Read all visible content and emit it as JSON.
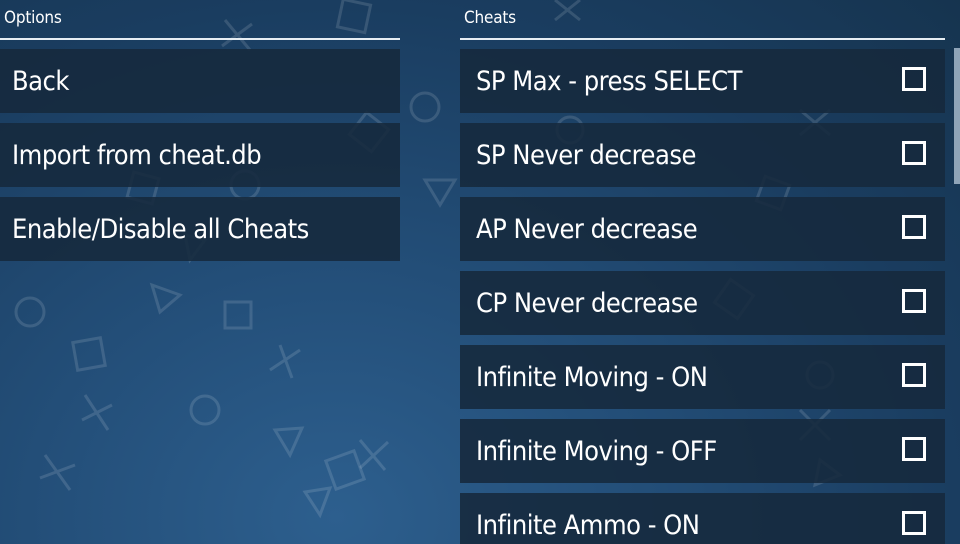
{
  "options": {
    "header": "Options",
    "items": [
      {
        "label": "Back"
      },
      {
        "label": "Import from cheat.db"
      },
      {
        "label": "Enable/Disable all Cheats"
      }
    ]
  },
  "cheats": {
    "header": "Cheats",
    "items": [
      {
        "label": "SP Max - press SELECT",
        "checked": false
      },
      {
        "label": "SP Never decrease",
        "checked": false
      },
      {
        "label": "AP Never decrease",
        "checked": false
      },
      {
        "label": "CP Never decrease",
        "checked": false
      },
      {
        "label": "Infinite Moving - ON",
        "checked": false
      },
      {
        "label": "Infinite Moving - OFF",
        "checked": false
      },
      {
        "label": "Infinite Ammo - ON",
        "checked": false
      }
    ]
  },
  "colors": {
    "background": "#1f4a72",
    "item_background": "#16293c",
    "text": "#ffffff"
  }
}
